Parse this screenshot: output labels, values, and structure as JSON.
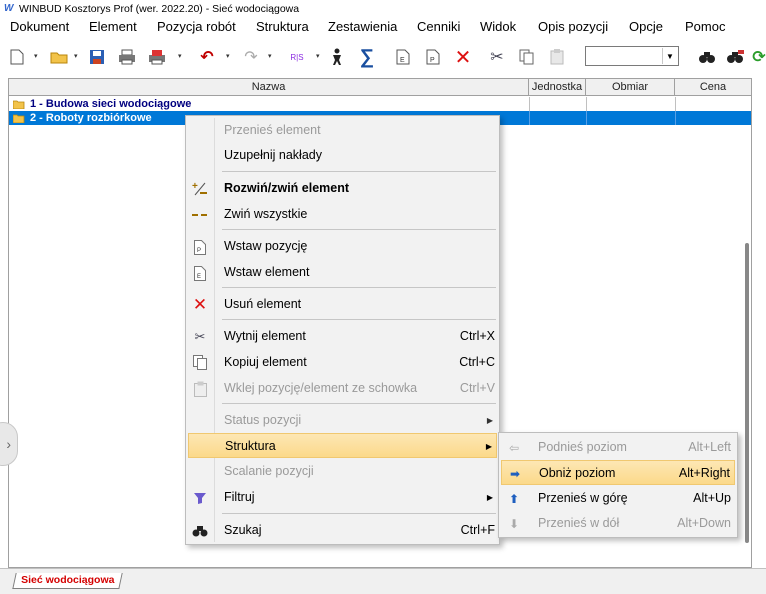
{
  "window": {
    "title": "WINBUD Kosztorys Prof (wer. 2022.20) - Sieć wodociągowa",
    "logo_text": "W"
  },
  "menubar": [
    {
      "label": "Dokument"
    },
    {
      "label": "Element"
    },
    {
      "label": "Pozycja robót"
    },
    {
      "label": "Struktura"
    },
    {
      "label": "Zestawienia"
    },
    {
      "label": "Cenniki"
    },
    {
      "label": "Widok"
    },
    {
      "label": "Opis pozycji"
    },
    {
      "label": "Opcje"
    },
    {
      "label": "Pomoc"
    }
  ],
  "toolbar": {
    "icons": [
      "new-document-icon",
      "open-folder-icon",
      "save-icon",
      "print-icon",
      "print-pdf-icon",
      "undo-icon",
      "redo-icon",
      "rms-icon",
      "position-icon",
      "sum-icon",
      "insert-element-icon",
      "insert-position-icon",
      "delete-icon",
      "cut-icon",
      "copy-icon",
      "paste-icon",
      "find-icon",
      "find-next-icon",
      "refresh-icon"
    ],
    "combo_value": ""
  },
  "grid": {
    "columns": [
      "Nazwa",
      "Jednostka",
      "Obmiar",
      "Cena"
    ],
    "rows": [
      {
        "label": "1 - Budowa sieci wodociągowe",
        "selected": false
      },
      {
        "label": "2 - Roboty rozbiórkowe",
        "selected": true
      }
    ]
  },
  "context_menu": {
    "items": [
      {
        "label": "Przenieś element",
        "shortcut": "",
        "disabled": true,
        "icon": ""
      },
      {
        "label": "Uzupełnij nakłady",
        "shortcut": "",
        "disabled": false,
        "icon": ""
      },
      {
        "label": "Rozwiń/zwiń element",
        "shortcut": "",
        "disabled": false,
        "icon": "expand-collapse-icon",
        "bold": true
      },
      {
        "label": "Zwiń wszystkie",
        "shortcut": "",
        "disabled": false,
        "icon": "collapse-all-icon"
      },
      {
        "label": "Wstaw pozycję",
        "shortcut": "",
        "disabled": false,
        "icon": "insert-position-icon"
      },
      {
        "label": "Wstaw element",
        "shortcut": "",
        "disabled": false,
        "icon": "insert-element-icon"
      },
      {
        "label": "Usuń element",
        "shortcut": "",
        "disabled": false,
        "icon": "delete-icon"
      },
      {
        "label": "Wytnij element",
        "shortcut": "Ctrl+X",
        "disabled": false,
        "icon": "cut-icon"
      },
      {
        "label": "Kopiuj element",
        "shortcut": "Ctrl+C",
        "disabled": false,
        "icon": "copy-icon"
      },
      {
        "label": "Wklej pozycję/element ze schowka",
        "shortcut": "Ctrl+V",
        "disabled": true,
        "icon": "paste-icon"
      },
      {
        "label": "Status pozycji",
        "shortcut": "",
        "disabled": true,
        "icon": "",
        "submenu": true
      },
      {
        "label": "Struktura",
        "shortcut": "",
        "disabled": false,
        "icon": "",
        "submenu": true,
        "highlighted": true
      },
      {
        "label": "Scalanie pozycji",
        "shortcut": "",
        "disabled": true,
        "icon": ""
      },
      {
        "label": "Filtruj",
        "shortcut": "",
        "disabled": false,
        "icon": "filter-icon",
        "submenu": true
      },
      {
        "label": "Szukaj",
        "shortcut": "Ctrl+F",
        "disabled": false,
        "icon": "binoculars-icon"
      }
    ]
  },
  "submenu": {
    "items": [
      {
        "label": "Podnieś poziom",
        "shortcut": "Alt+Left",
        "disabled": true,
        "icon": "arrow-left-icon"
      },
      {
        "label": "Obniż poziom",
        "shortcut": "Alt+Right",
        "disabled": false,
        "icon": "arrow-right-icon",
        "highlighted": true
      },
      {
        "label": "Przenieś w górę",
        "shortcut": "Alt+Up",
        "disabled": false,
        "icon": "arrow-up-icon"
      },
      {
        "label": "Przenieś w dół",
        "shortcut": "Alt+Down",
        "disabled": true,
        "icon": "arrow-down-icon"
      }
    ]
  },
  "tabs": [
    {
      "label": "Sieć wodociągowa",
      "active": true
    }
  ],
  "colors": {
    "selection": "#0078d7",
    "highlight": "#fbd98a",
    "tab_text": "#d40000",
    "row_text": "#000080"
  }
}
